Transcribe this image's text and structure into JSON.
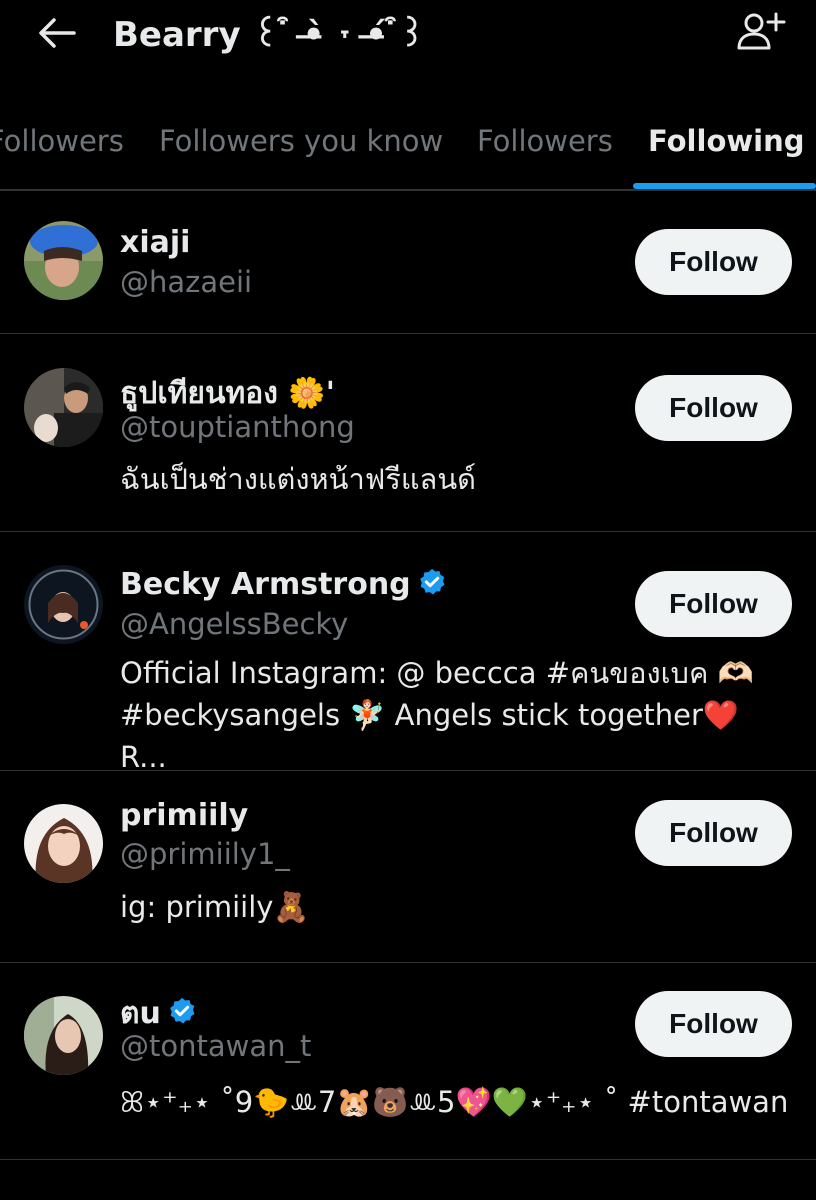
{
  "header": {
    "title": "Bearry ꒰ ͒ •̶̀ ˕ •̶́ ͒꒱",
    "back_icon": "arrow-left-icon",
    "add_user_icon": "person-add-icon"
  },
  "tabs": [
    {
      "label": "Followers",
      "active": false
    },
    {
      "label": "Followers you know",
      "active": false
    },
    {
      "label": "Followers",
      "active": false
    },
    {
      "label": "Following",
      "active": true
    }
  ],
  "accent_color": "#1d9bf0",
  "verified_color": "#1d9bf0",
  "users": [
    {
      "name": "xiaji",
      "handle": "@hazaeii",
      "bio": "",
      "verified": false,
      "follow_label": "Follow"
    },
    {
      "name": "ธูปเทียนทอง 🌼'",
      "handle": "@touptianthong",
      "bio": "ฉันเป็นช่างแต่งหน้าฟรีแลนด์",
      "verified": false,
      "follow_label": "Follow"
    },
    {
      "name": "Becky Armstrong",
      "handle": "@AngelssBecky",
      "bio": "Official Instagram: @ beccca #คนของเบค 🫶🏻 #beckysangels 🧚🏻 Angels stick together❤️ R...",
      "verified": true,
      "follow_label": "Follow"
    },
    {
      "name": "primiily",
      "handle": "@primiily1_",
      "bio": "ig: primiily🧸",
      "verified": false,
      "follow_label": "Follow"
    },
    {
      "name": "ตu",
      "handle": "@tontawan_t",
      "bio": "ꕤ⋆⁺₊⋆ ˚9🐤ꔛ7🐹🐻ꔛ5💖💚⋆⁺₊⋆ ˚ #tontawan",
      "verified": true,
      "follow_label": "Follow"
    }
  ]
}
